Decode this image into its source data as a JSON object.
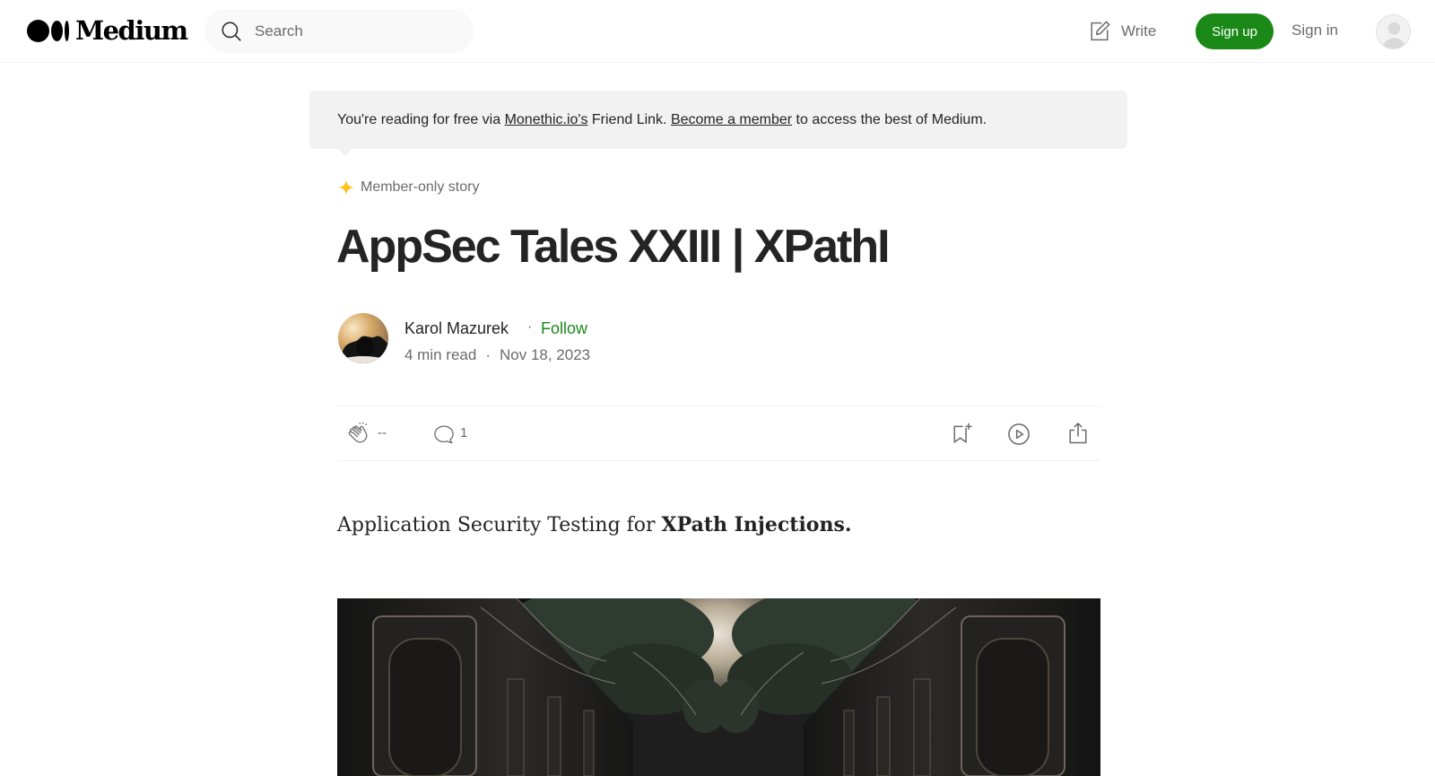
{
  "header": {
    "logo_text": "Medium",
    "search_placeholder": "Search",
    "write_label": "Write",
    "signup_label": "Sign up",
    "signin_label": "Sign in"
  },
  "banner": {
    "prefix": "You're reading for free via ",
    "link1": "Monethic.io's",
    "middle": " Friend Link. ",
    "link2": "Become a member",
    "suffix": " to access the best of Medium."
  },
  "article": {
    "member_label": "Member-only story",
    "title": "AppSec Tales XXIII | XPathI",
    "author": "Karol Mazurek",
    "dot": "·",
    "follow_label": "Follow",
    "read_time": "4 min read",
    "date": "Nov 18, 2023",
    "clap_count": "--",
    "comment_count": "1",
    "subtitle_plain": "Application Security Testing for ",
    "subtitle_bold": "XPath Injections."
  },
  "colors": {
    "accent": "#1a8917",
    "star": "#ffc017",
    "text": "#242424",
    "muted": "#6b6b6b"
  }
}
